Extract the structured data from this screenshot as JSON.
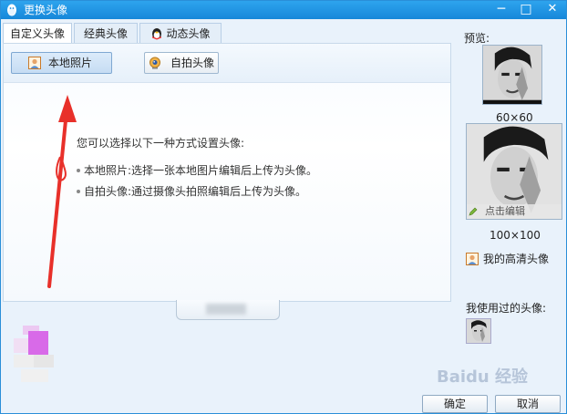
{
  "window": {
    "title": "更换头像",
    "minimize_glyph": "─",
    "maximize_glyph": "□",
    "close_glyph": "✕"
  },
  "tabs": [
    {
      "label": "自定义头像",
      "active": true
    },
    {
      "label": "经典头像",
      "active": false
    },
    {
      "label": "动态头像",
      "active": false
    }
  ],
  "toolbar": {
    "local_photo_label": "本地照片",
    "selfie_label": "自拍头像"
  },
  "instructions": {
    "heading": "您可以选择以下一种方式设置头像:",
    "items": [
      "本地照片:选择一张本地图片编辑后上传为头像。",
      "自拍头像:通过摄像头拍照编辑后上传为头像。"
    ]
  },
  "sidebar": {
    "preview_label": "预览:",
    "small_size": "60×60",
    "big_size": "100×100",
    "edit_label": "点击编辑",
    "hd_avatar_label": "我的高清头像",
    "used_label": "我使用过的头像:"
  },
  "footer": {
    "ok_label": "确定",
    "cancel_label": "取消"
  },
  "watermark": "Baidu 经验",
  "colors": {
    "titlebar": "#1e96e6",
    "window_bg": "#e9f2fb",
    "arrow": "#e8302a",
    "active_button": "#c6dcf3"
  },
  "icons": {
    "title_logo": "qq-penguin-icon",
    "local_photo": "person-photo-icon",
    "selfie": "webcam-icon",
    "dynamic_tab": "qq-penguin-icon",
    "edit": "pencil-icon",
    "hd": "person-photo-icon"
  }
}
